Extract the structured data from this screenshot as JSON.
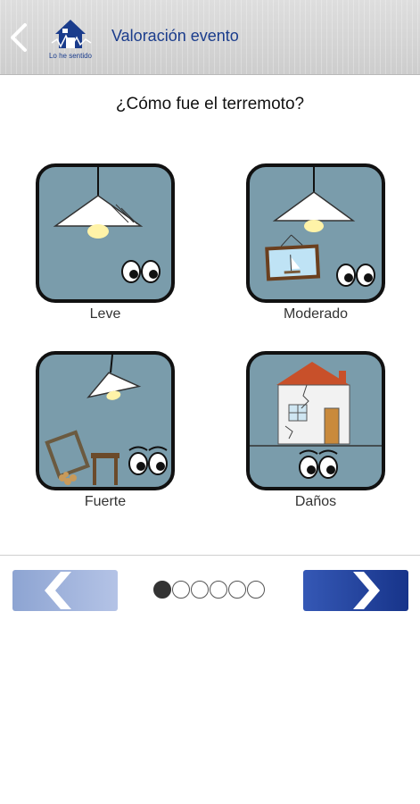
{
  "header": {
    "title": "Valoración evento",
    "logo_text": "Lo he sentido",
    "back_icon": "chevron-left-icon"
  },
  "question": "¿Cómo fue el terremoto?",
  "options": [
    {
      "label": "Leve",
      "icon": "lamp-icon"
    },
    {
      "label": "Moderado",
      "icon": "lamp-picture-icon"
    },
    {
      "label": "Fuerte",
      "icon": "falling-furniture-icon"
    },
    {
      "label": "Daños",
      "icon": "damaged-house-icon"
    }
  ],
  "pagination": {
    "total": 6,
    "current": 1
  },
  "navigation": {
    "prev_icon": "chevron-left-icon",
    "next_icon": "chevron-right-icon"
  },
  "colors": {
    "accent": "#1a3c8c",
    "tile_bg": "#7a9cab",
    "next_button": "#17348a",
    "prev_button": "#8da4d2"
  }
}
